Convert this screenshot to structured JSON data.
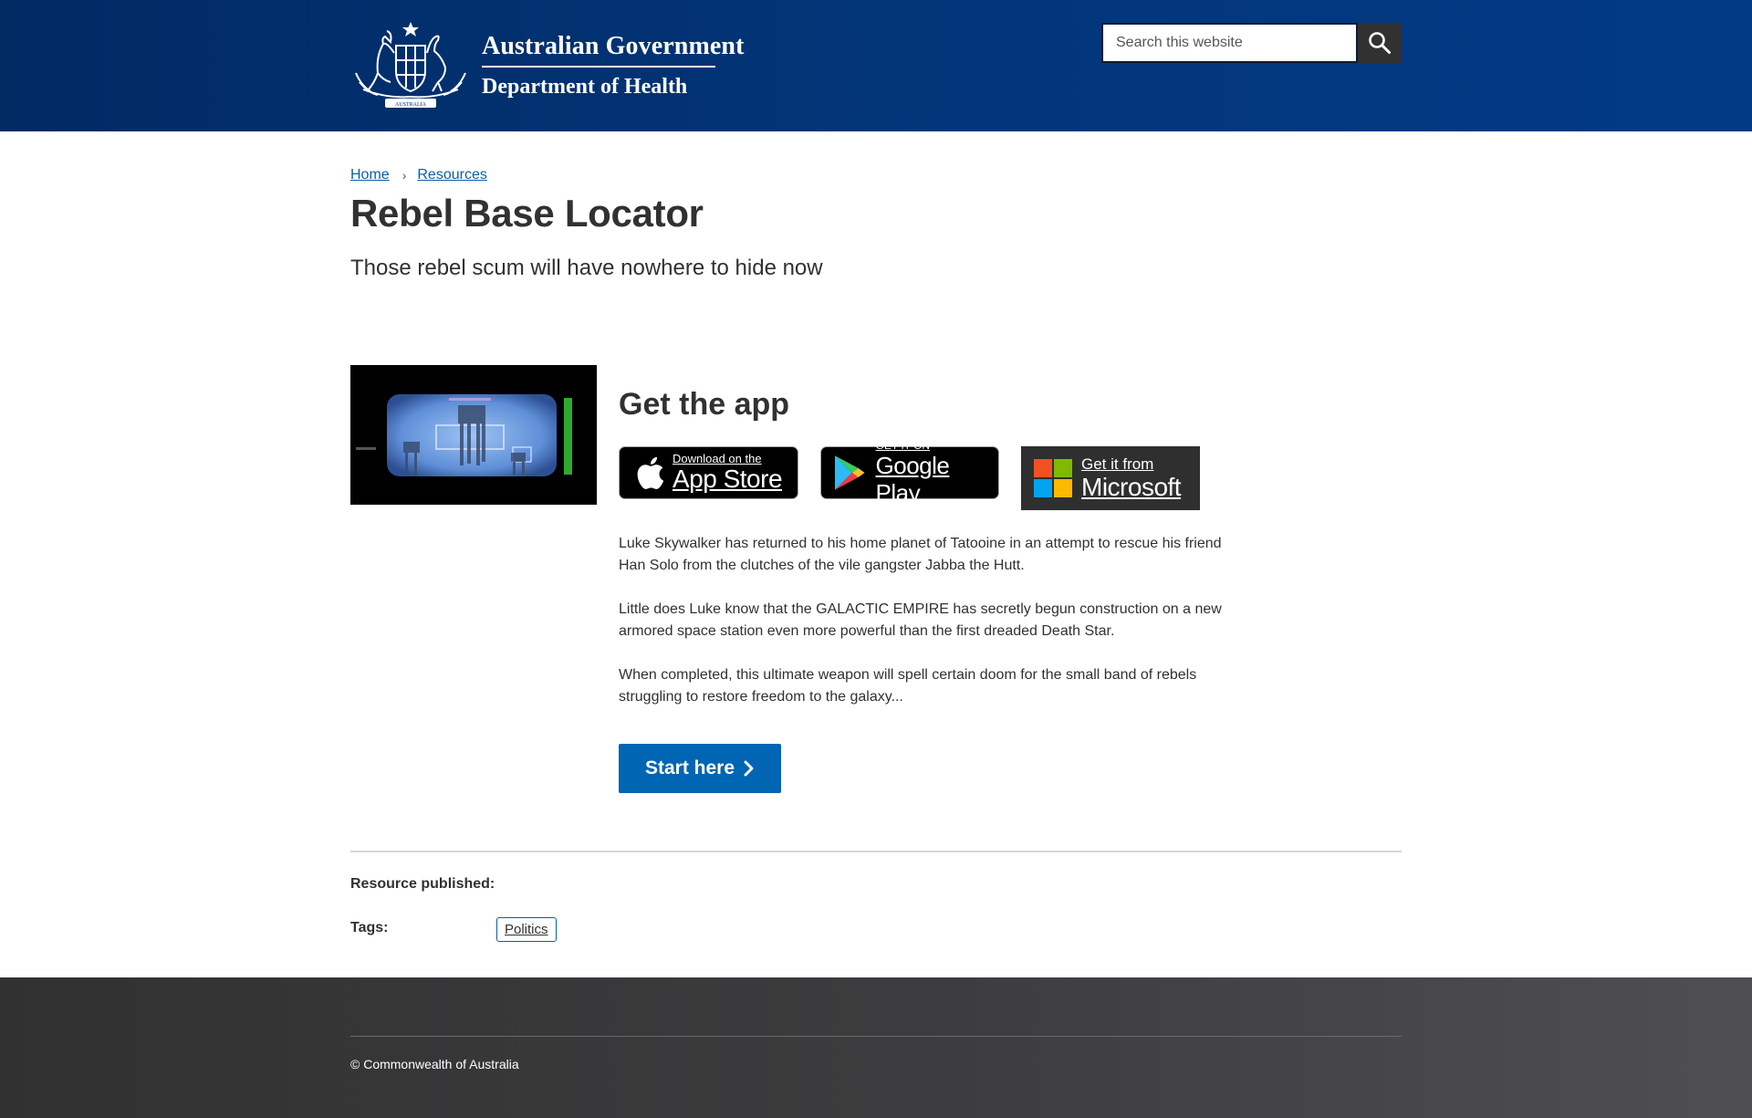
{
  "header": {
    "brand_primary": "Australian Government",
    "brand_secondary": "Department of Health",
    "search_placeholder": "Search this website",
    "colors": {
      "header_bg": "#012a63",
      "search_button_bg": "#313131"
    }
  },
  "breadcrumb": {
    "items": [
      "Home",
      "Resources"
    ]
  },
  "page": {
    "title": "Rebel Base Locator",
    "lede": "Those rebel scum will have nowhere to hide now"
  },
  "app": {
    "heading": "Get the app",
    "badges": {
      "apple": {
        "small": "Download on the",
        "big": "App Store"
      },
      "google": {
        "small": "GET IT ON",
        "big": "Google Play"
      },
      "microsoft": {
        "small": "Get it from",
        "big": "Microsoft"
      }
    }
  },
  "body": {
    "paragraphs": [
      "Luke Skywalker has returned to his home planet of Tatooine in an attempt to rescue his friend Han Solo from the clutches of the vile gangster Jabba the Hutt.",
      "Little does Luke know that the GALACTIC EMPIRE has secretly begun construction on a new armored space station even more powerful than the first dreaded Death Star.",
      "When completed, this ultimate weapon will spell certain doom for the small band of rebels struggling to restore freedom to the galaxy..."
    ]
  },
  "cta": {
    "label": "Start here",
    "color": "#0065b3"
  },
  "meta": {
    "published_label": "Resource published:",
    "tags_label": "Tags:",
    "tags": [
      "Politics"
    ]
  },
  "footer": {
    "copyright": "© Commonwealth of Australia"
  }
}
